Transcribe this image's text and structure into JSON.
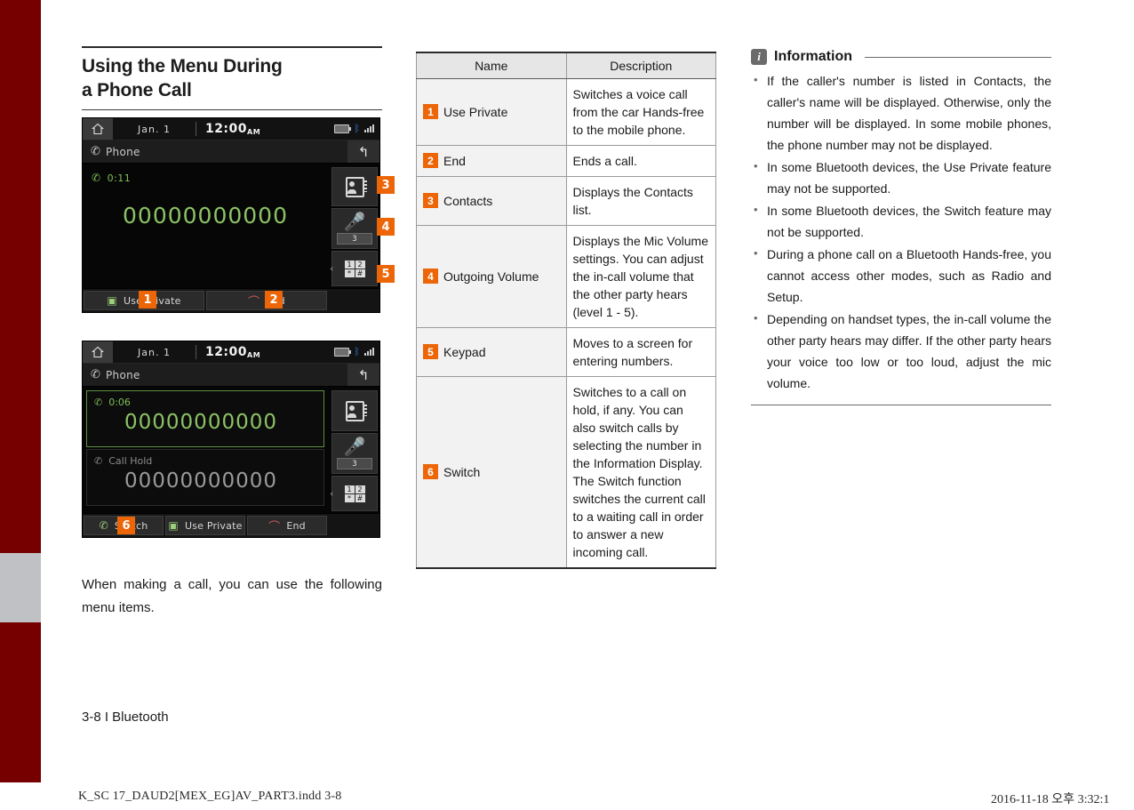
{
  "sidebar": {
    "color": "#760000",
    "tab_color": "#bfc1c4"
  },
  "section": {
    "title_line1": "Using the Menu During",
    "title_line2": "a Phone Call"
  },
  "screenshot_one": {
    "status": {
      "home_icon": "home-icon",
      "date": "Jan.  1",
      "time": "12:00",
      "ampm": "AM",
      "battery_icon": "battery-icon",
      "bluetooth_icon": "bluetooth-icon",
      "signal_icon": "signal-icon"
    },
    "titlebar": {
      "label": "Phone",
      "phone_icon": "phone-handset-icon",
      "back_icon": "back-arrow-icon"
    },
    "call": {
      "timer": "0:11",
      "number": "00000000000",
      "call_icon": "outgoing-call-icon"
    },
    "rail": {
      "contacts_icon": "contacts-book-icon",
      "mic_icon": "mic-mute-icon",
      "mic_level": "3",
      "keypad_icon": "keypad-icon",
      "keypad_keys": [
        "1",
        "2",
        "*",
        "#"
      ],
      "expand_arrow": "‹"
    },
    "buttons": [
      {
        "label": "Use Private",
        "icon": "private-call-icon"
      },
      {
        "label": "End",
        "icon": "end-call-icon"
      }
    ],
    "badges": {
      "use_private": "1",
      "end": "2",
      "contacts": "3",
      "volume": "4",
      "keypad": "5"
    }
  },
  "screenshot_two": {
    "status": {
      "home_icon": "home-icon",
      "date": "Jan.  1",
      "time": "12:00",
      "ampm": "AM",
      "battery_icon": "battery-icon",
      "bluetooth_icon": "bluetooth-icon",
      "signal_icon": "signal-icon"
    },
    "titlebar": {
      "label": "Phone",
      "phone_icon": "phone-handset-icon",
      "back_icon": "back-arrow-icon"
    },
    "active_call": {
      "timer": "0:06",
      "number": "00000000000",
      "call_icon": "outgoing-call-icon"
    },
    "held_call": {
      "label": "Call Hold",
      "number": "00000000000",
      "call_icon": "hold-call-icon"
    },
    "rail": {
      "contacts_icon": "contacts-book-icon",
      "mic_icon": "mic-mute-icon",
      "mic_level": "3",
      "keypad_icon": "keypad-icon",
      "keypad_keys": [
        "1",
        "2",
        "*",
        "#"
      ],
      "expand_arrow": "‹"
    },
    "buttons": [
      {
        "label": "Switch",
        "icon": "switch-call-icon"
      },
      {
        "label": "Use Private",
        "icon": "private-call-icon"
      },
      {
        "label": "End",
        "icon": "end-call-icon"
      }
    ],
    "badges": {
      "switch": "6"
    }
  },
  "body_paragraph": "When making a call, you can use the following menu items.",
  "table": {
    "headers": [
      "Name",
      "Description"
    ],
    "rows": [
      {
        "num": "1",
        "name": "Use Private",
        "description": "Switches a voice call from the car Hands-free to the mobile phone."
      },
      {
        "num": "2",
        "name": "End",
        "description": "Ends a call."
      },
      {
        "num": "3",
        "name": "Contacts",
        "description": "Displays the Contacts list."
      },
      {
        "num": "4",
        "name": "Outgoing Volume",
        "description": "Displays the Mic Volume settings. You can adjust the in-call volume that the other party hears (level 1 - 5)."
      },
      {
        "num": "5",
        "name": "Keypad",
        "description": "Moves to a screen for entering numbers."
      },
      {
        "num": "6",
        "name": "Switch",
        "description": "Switches to a call on hold, if any. You can also switch calls by selecting the number in the Information Display. The Switch function switches the current call to a waiting call in order to answer a new incoming call."
      }
    ]
  },
  "information": {
    "icon": "info-icon",
    "title": "Information",
    "items": [
      "If the caller's number is listed in Contacts, the caller's name will be displayed. Otherwise, only the number will be displayed. In some mobile phones, the phone number may not be displayed.",
      "In some Bluetooth devices, the Use Private feature may not be supported.",
      "In some Bluetooth devices, the Switch feature may not be supported.",
      "During a phone call on a Bluetooth Hands-free, you cannot access other modes, such as Radio and Setup.",
      "Depending on handset types, the in-call volume the other party hears may differ. If the other party hears your voice too low or too loud, adjust the mic volume."
    ]
  },
  "page_footer": "3-8 I Bluetooth",
  "print_bar": {
    "left": "K_SC 17_DAUD2[MEX_EG]AV_PART3.indd   3-8",
    "right": "2016-11-18   오후 3:32:1"
  }
}
